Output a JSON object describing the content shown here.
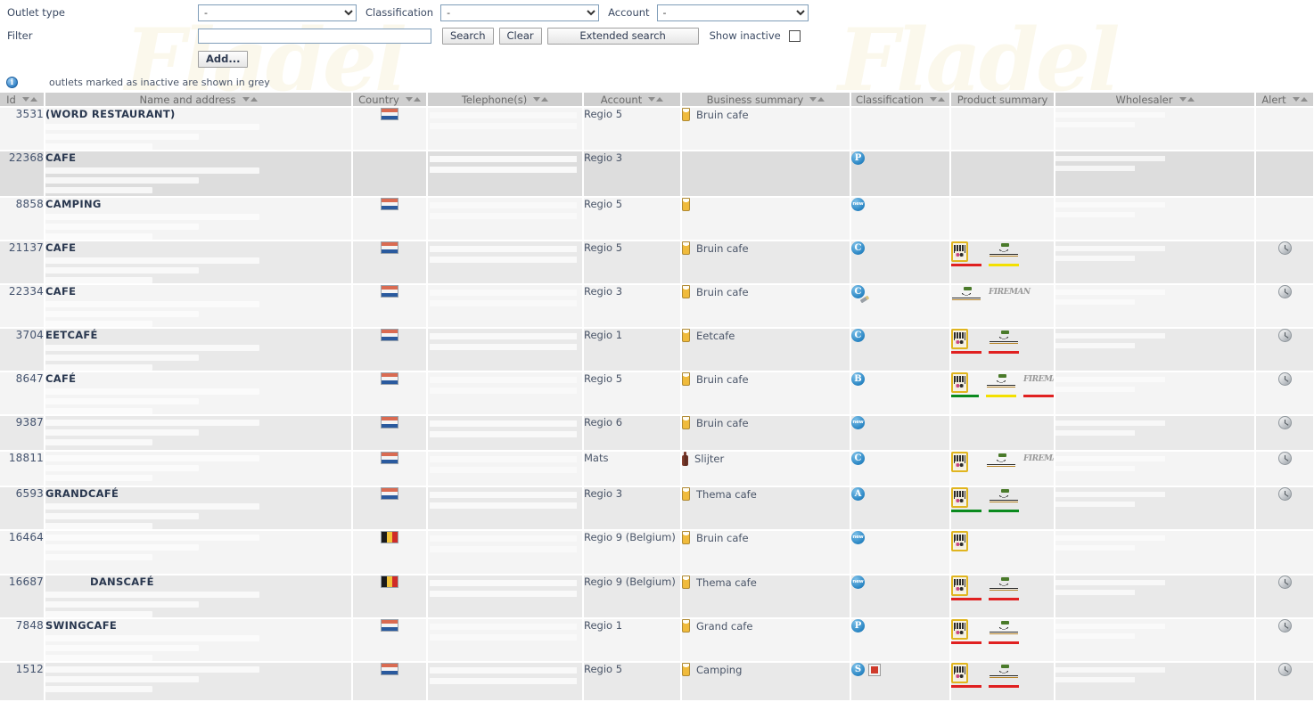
{
  "watermark_text": "Fladel",
  "filters": {
    "outlet_type_label": "Outlet type",
    "outlet_type_value": "-",
    "classification_label": "Classification",
    "classification_value": "-",
    "account_label": "Account",
    "account_value": "-",
    "filter_label": "Filter",
    "filter_value": "",
    "filter_placeholder": "",
    "search_button": "Search",
    "clear_button": "Clear",
    "extended_search_button": "Extended search",
    "show_inactive_label": "Show inactive",
    "show_inactive_checked": false,
    "add_button": "Add..."
  },
  "info": {
    "icon": "info-icon",
    "text": "outlets marked as inactive are shown in grey"
  },
  "table": {
    "columns": [
      {
        "label": "Id",
        "sortable": true
      },
      {
        "label": "Name and address",
        "sortable": true
      },
      {
        "label": "Country",
        "sortable": true
      },
      {
        "label": "Telephone(s)",
        "sortable": true
      },
      {
        "label": "Account",
        "sortable": true
      },
      {
        "label": "Business summary",
        "sortable": true
      },
      {
        "label": "Classification",
        "sortable": true
      },
      {
        "label": "Product summary",
        "sortable": false
      },
      {
        "label": "Wholesaler",
        "sortable": true
      },
      {
        "label": "Alert",
        "sortable": true
      }
    ],
    "rows": [
      {
        "id": "3531",
        "name": "(WORD RESTAURANT)",
        "indent": false,
        "country": "nl",
        "account": "Regio 5",
        "business": "Bruin cafe",
        "business_icon": "beer-glass-icon",
        "classification": [],
        "products": [],
        "alert": false,
        "inactive": false
      },
      {
        "id": "22368",
        "name": "CAFE",
        "indent": false,
        "country": "",
        "account": "Regio 3",
        "business": "",
        "business_icon": "",
        "classification": [
          {
            "text": "P",
            "style": "letter"
          }
        ],
        "products": [],
        "alert": false,
        "inactive": true
      },
      {
        "id": "8858",
        "name": "CAMPING",
        "indent": false,
        "country": "nl",
        "account": "Regio 5",
        "business": "",
        "business_icon": "beer-glass-icon",
        "classification": [
          {
            "text": "new",
            "style": "new"
          }
        ],
        "products": [],
        "alert": false,
        "inactive": false
      },
      {
        "id": "21137",
        "name": "CAFE",
        "indent": false,
        "country": "nl",
        "account": "Regio 5",
        "business": "Bruin cafe",
        "business_icon": "beer-glass-icon",
        "classification": [
          {
            "text": "C",
            "style": "letter"
          }
        ],
        "products": [
          {
            "brand": "budels",
            "bar": "red"
          },
          {
            "brand": "script",
            "bar": "yellow"
          }
        ],
        "alert": true,
        "inactive": false
      },
      {
        "id": "22334",
        "name": "CAFE",
        "indent": false,
        "country": "nl",
        "account": "Regio 3",
        "business": "Bruin cafe",
        "business_icon": "beer-glass-icon",
        "classification": [
          {
            "text": "C",
            "style": "letter-pencil"
          }
        ],
        "products": [
          {
            "brand": "script",
            "bar": "none"
          },
          {
            "brand": "fireman",
            "bar": "none"
          }
        ],
        "alert": true,
        "inactive": false
      },
      {
        "id": "3704",
        "name": "EETCAFÉ",
        "indent": false,
        "country": "nl",
        "account": "Regio 1",
        "business": "Eetcafe",
        "business_icon": "beer-glass-icon",
        "classification": [
          {
            "text": "C",
            "style": "letter"
          }
        ],
        "products": [
          {
            "brand": "budels",
            "bar": "red"
          },
          {
            "brand": "script",
            "bar": "red"
          }
        ],
        "alert": true,
        "inactive": false
      },
      {
        "id": "8647",
        "name": "CAFÉ",
        "indent": false,
        "country": "nl",
        "account": "Regio 5",
        "business": "Bruin cafe",
        "business_icon": "beer-glass-icon",
        "classification": [
          {
            "text": "B",
            "style": "letter"
          }
        ],
        "products": [
          {
            "brand": "budels",
            "bar": "green"
          },
          {
            "brand": "script",
            "bar": "yellow"
          },
          {
            "brand": "fireman",
            "bar": "red"
          }
        ],
        "alert": true,
        "inactive": false
      },
      {
        "id": "9387",
        "name": "",
        "indent": false,
        "country": "nl",
        "account": "Regio 6",
        "business": "Bruin cafe",
        "business_icon": "beer-glass-icon",
        "classification": [
          {
            "text": "new",
            "style": "new"
          }
        ],
        "products": [],
        "alert": true,
        "inactive": false
      },
      {
        "id": "18811",
        "name": "",
        "indent": false,
        "country": "nl",
        "account": "Mats",
        "business": "Slijter",
        "business_icon": "bottle-icon",
        "classification": [
          {
            "text": "C",
            "style": "letter"
          }
        ],
        "products": [
          {
            "brand": "budels",
            "bar": "none"
          },
          {
            "brand": "script",
            "bar": "none"
          },
          {
            "brand": "fireman",
            "bar": "none"
          }
        ],
        "alert": true,
        "inactive": false
      },
      {
        "id": "6593",
        "name": "GRANDCAFÉ",
        "indent": false,
        "country": "nl",
        "account": "Regio 3",
        "business": "Thema cafe",
        "business_icon": "beer-glass-icon",
        "classification": [
          {
            "text": "A",
            "style": "letter"
          }
        ],
        "products": [
          {
            "brand": "budels",
            "bar": "green"
          },
          {
            "brand": "script",
            "bar": "green"
          }
        ],
        "alert": true,
        "inactive": false
      },
      {
        "id": "16464",
        "name": "",
        "indent": false,
        "country": "be",
        "account": "Regio 9 (Belgium)",
        "business": "Bruin cafe",
        "business_icon": "beer-glass-icon",
        "classification": [
          {
            "text": "new",
            "style": "new"
          }
        ],
        "products": [
          {
            "brand": "budels",
            "bar": "none"
          }
        ],
        "alert": false,
        "inactive": false
      },
      {
        "id": "16687",
        "name": "DANSCAFÉ",
        "indent": true,
        "country": "be",
        "account": "Regio 9 (Belgium)",
        "business": "Thema cafe",
        "business_icon": "beer-glass-icon",
        "classification": [
          {
            "text": "new",
            "style": "new"
          }
        ],
        "products": [
          {
            "brand": "budels",
            "bar": "red"
          },
          {
            "brand": "script",
            "bar": "red"
          }
        ],
        "alert": true,
        "inactive": false
      },
      {
        "id": "7848",
        "name": "SWINGCAFE",
        "indent": false,
        "country": "nl",
        "account": "Regio 1",
        "business": "Grand cafe",
        "business_icon": "beer-glass-icon",
        "classification": [
          {
            "text": "P",
            "style": "letter"
          }
        ],
        "products": [
          {
            "brand": "budels",
            "bar": "red"
          },
          {
            "brand": "script",
            "bar": "red"
          }
        ],
        "alert": true,
        "inactive": false
      },
      {
        "id": "1512",
        "name": "",
        "indent": false,
        "country": "nl",
        "account": "Regio 5",
        "business": "Camping",
        "business_icon": "beer-glass-icon",
        "classification": [
          {
            "text": "S",
            "style": "letter"
          },
          {
            "text": "",
            "style": "doc"
          }
        ],
        "products": [
          {
            "brand": "budels",
            "bar": "red"
          },
          {
            "brand": "script",
            "bar": "red"
          }
        ],
        "alert": true,
        "inactive": false
      }
    ]
  }
}
